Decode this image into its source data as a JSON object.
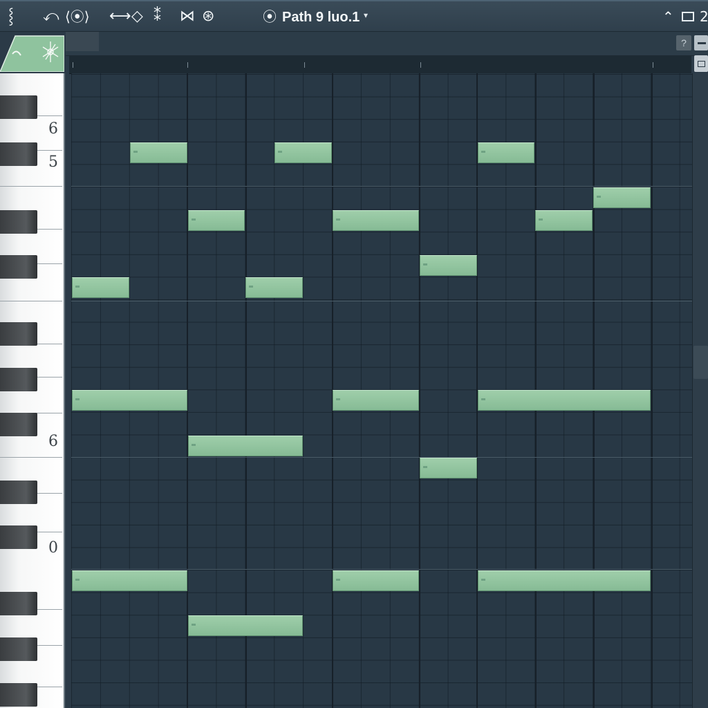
{
  "toolbar": {
    "icons": [
      {
        "name": "info-icon",
        "glyph": "⸾"
      },
      {
        "name": "undo-icon",
        "glyph": "⤺"
      },
      {
        "name": "tool-icon-1",
        "glyph": "⟨⦿⟩"
      },
      {
        "name": "tool-icon-2",
        "glyph": "⟷"
      },
      {
        "name": "tool-icon-3",
        "glyph": "◇"
      },
      {
        "name": "tool-icon-4",
        "glyph": "⁑"
      },
      {
        "name": "tool-icon-5",
        "glyph": "⋈"
      },
      {
        "name": "tool-icon-6",
        "glyph": "⊛"
      }
    ],
    "pattern_name": "Path 9 luo.1",
    "pattern_icon": "⦿",
    "pattern_caret": "▾",
    "right_caret": "⌃",
    "right_label": "2"
  },
  "header": {
    "help_label": "?"
  },
  "keyboard": {
    "octave_labels": [
      "6",
      "5",
      "6",
      "0"
    ]
  },
  "notes": [
    {
      "start": 2,
      "length": 2,
      "row": 3
    },
    {
      "start": 7,
      "length": 2,
      "row": 3
    },
    {
      "start": 14,
      "length": 2,
      "row": 3
    },
    {
      "start": 18,
      "length": 2,
      "row": 5
    },
    {
      "start": 4,
      "length": 2,
      "row": 6
    },
    {
      "start": 9,
      "length": 3,
      "row": 6
    },
    {
      "start": 16,
      "length": 2,
      "row": 6
    },
    {
      "start": 12,
      "length": 2,
      "row": 8
    },
    {
      "start": 0,
      "length": 2,
      "row": 9
    },
    {
      "start": 6,
      "length": 2,
      "row": 9
    },
    {
      "start": 0,
      "length": 4,
      "row": 14
    },
    {
      "start": 9,
      "length": 3,
      "row": 14
    },
    {
      "start": 14,
      "length": 6,
      "row": 14
    },
    {
      "start": 4,
      "length": 4,
      "row": 16
    },
    {
      "start": 12,
      "length": 2,
      "row": 17
    },
    {
      "start": 0,
      "length": 4,
      "row": 22
    },
    {
      "start": 9,
      "length": 3,
      "row": 22
    },
    {
      "start": 14,
      "length": 6,
      "row": 22
    },
    {
      "start": 4,
      "length": 4,
      "row": 24
    }
  ],
  "colors": {
    "note": "#93c59f",
    "grid_bg": "#283845",
    "toolbar": "#34444f"
  }
}
